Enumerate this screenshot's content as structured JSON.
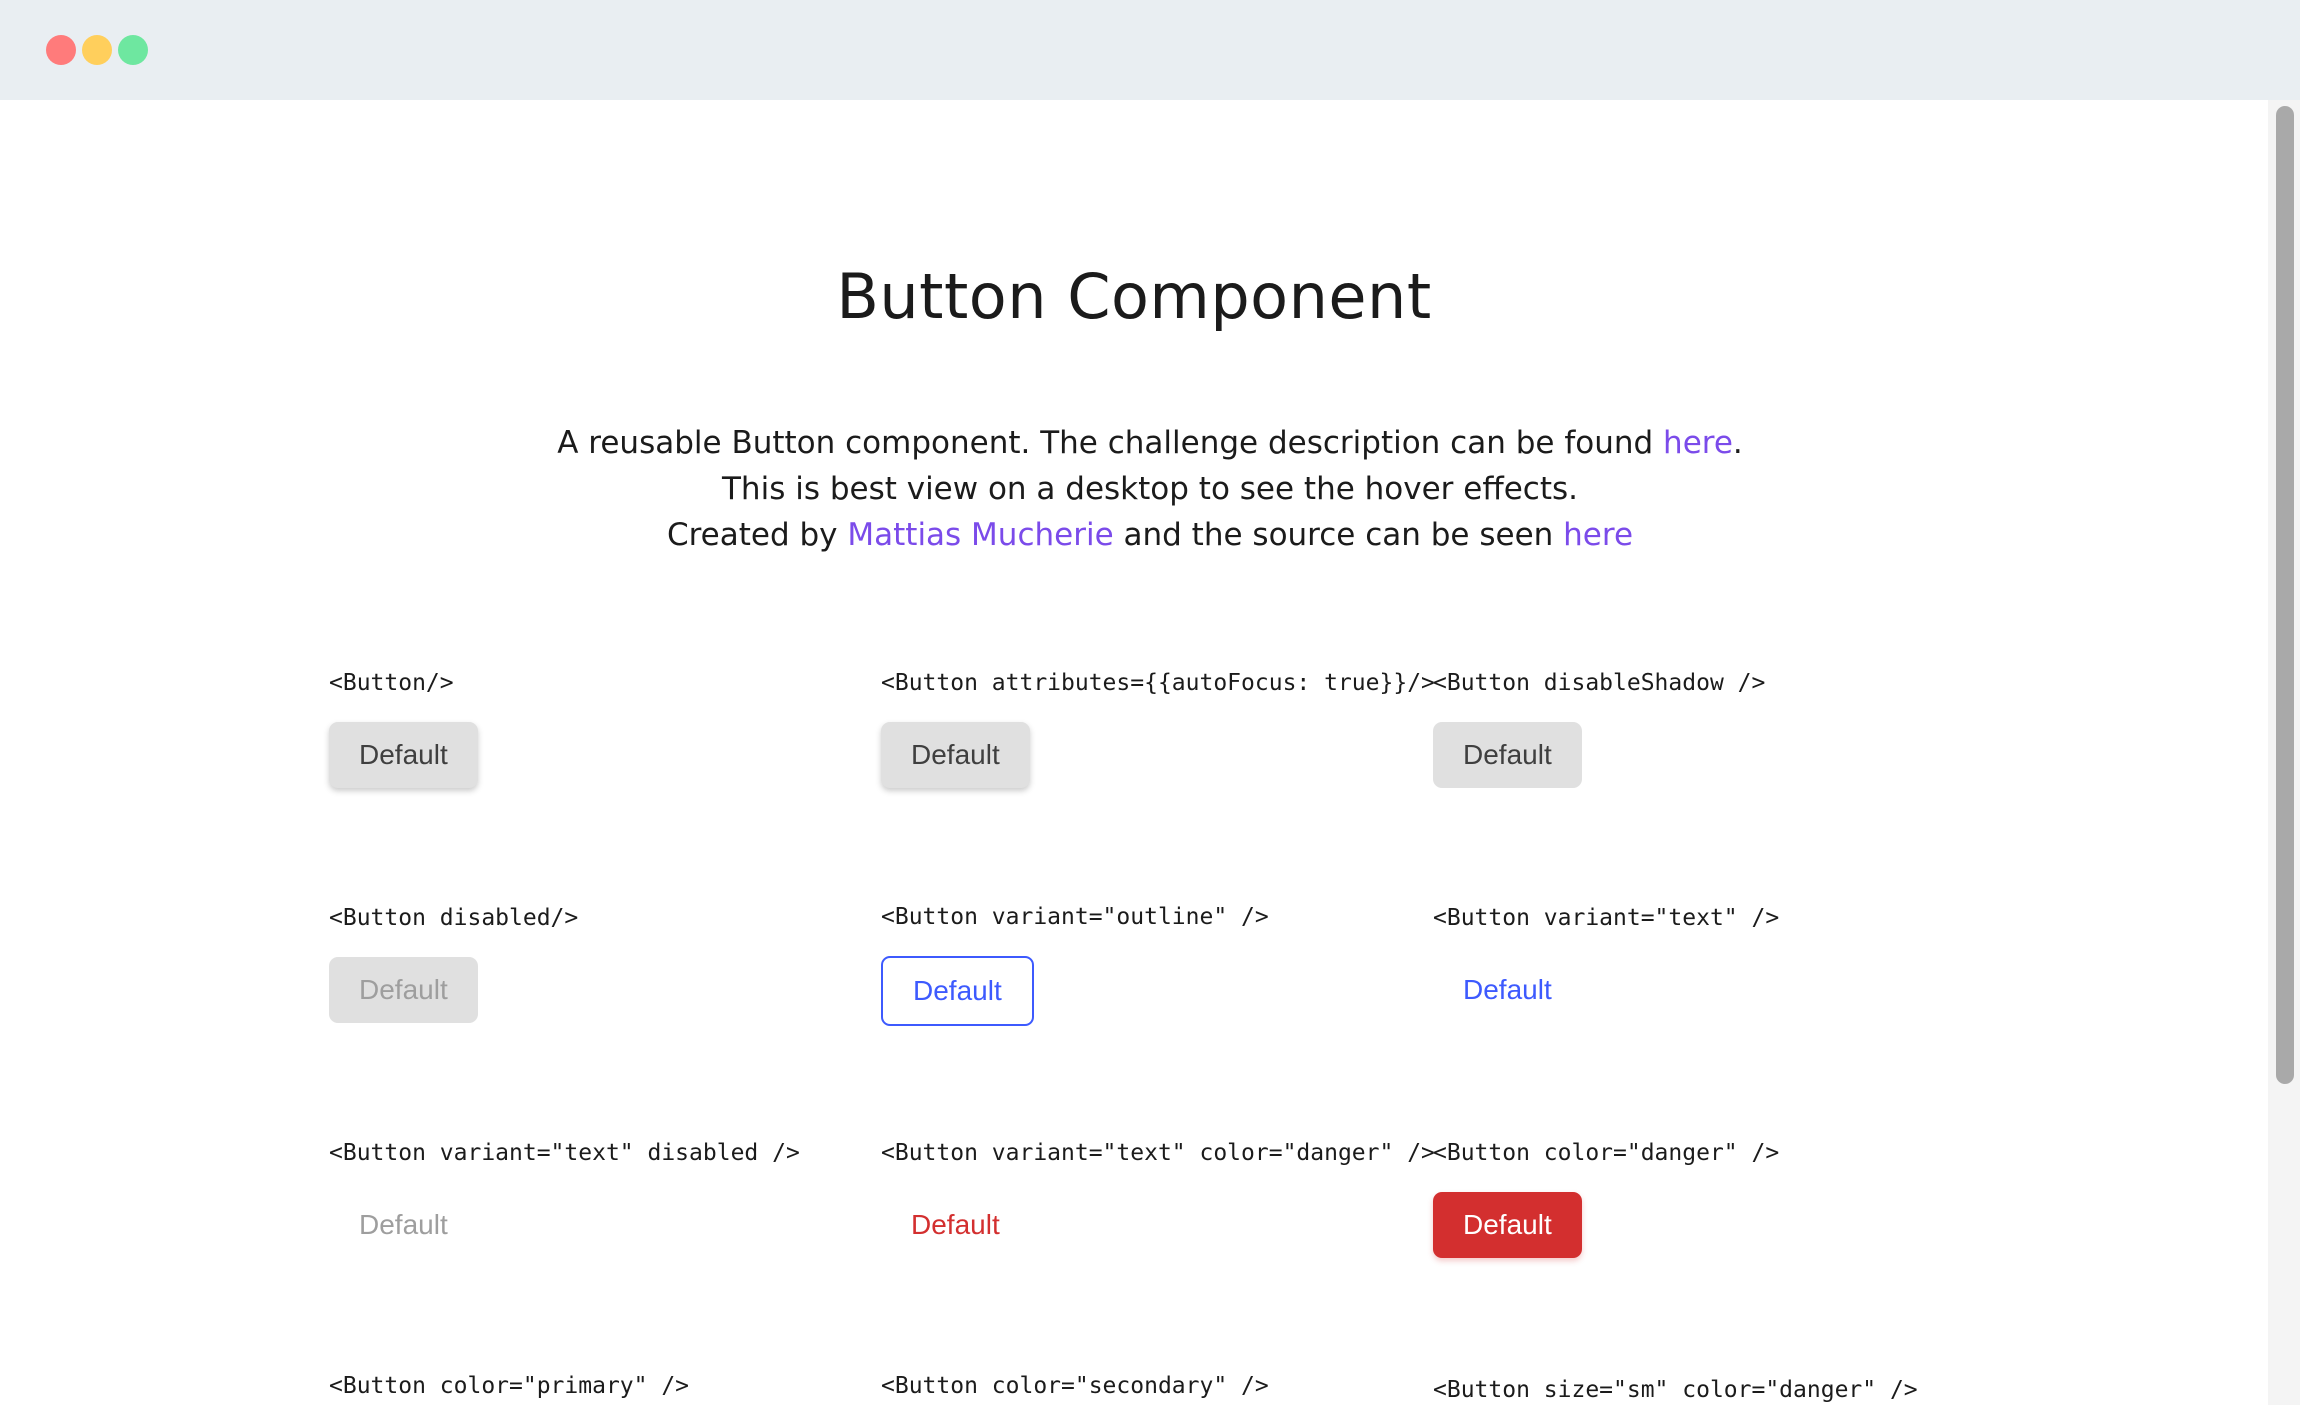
{
  "page": {
    "title": "Button Component",
    "intro": {
      "line1_text": "A reusable Button component. The challenge description can be found ",
      "line1_link": "here",
      "line1_end": ".",
      "line2_text": "This is best view on a desktop to see the hover effects.",
      "line3_text_a": "Created by ",
      "line3_author": "Mattias Mucherie",
      "line3_text_b": " and the source can be seen ",
      "line3_link": "here"
    }
  },
  "examples": [
    {
      "code": "<Button/>",
      "label": "Default"
    },
    {
      "code": "<Button attributes={{autoFocus: true}}/>",
      "label": "Default"
    },
    {
      "code": "<Button disableShadow />",
      "label": "Default"
    },
    {
      "code": "<Button disabled/>",
      "label": "Default"
    },
    {
      "code": "<Button variant=\"outline\" />",
      "label": "Default"
    },
    {
      "code": "<Button variant=\"text\" />",
      "label": "Default"
    },
    {
      "code": "<Button variant=\"text\" disabled />",
      "label": "Default"
    },
    {
      "code": "<Button variant=\"text\" color=\"danger\" />",
      "label": "Default"
    },
    {
      "code": "<Button color=\"danger\" />",
      "label": "Default"
    },
    {
      "code": "<Button color=\"primary\" />"
    },
    {
      "code": "<Button color=\"secondary\" />"
    },
    {
      "code": "<Button size=\"sm\" color=\"danger\" />"
    }
  ],
  "colors": {
    "link": "#7b4bea",
    "primary": "#3d5afe",
    "danger": "#d32f2f",
    "default_bg": "#e0e0e0",
    "titlebar": "#e9eef2"
  }
}
